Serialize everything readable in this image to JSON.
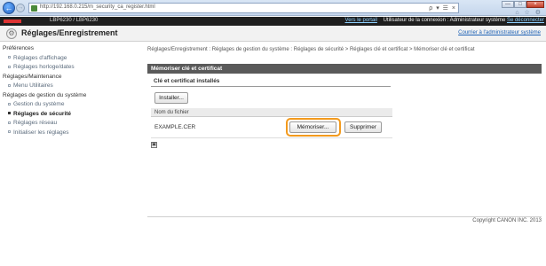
{
  "browser": {
    "url": "http://192.168.0.215/m_security_ca_register.html",
    "search_glyphs": "ρ ▾ ☰ ×",
    "tools_glyphs": "⌂ ☆ ⚙",
    "window_buttons": [
      "—",
      "□",
      "×"
    ]
  },
  "topbar": {
    "model": "LBP6230 / LBP6230",
    "portal_link": "Vers le portail",
    "user_text": "Utilisateur de la connexion : Administrateur système",
    "logout_link": "Se déconnecter"
  },
  "header": {
    "title": "Réglages/Enregistrement",
    "admin_link": "Courrier à l'administrateur système"
  },
  "sidebar": {
    "groups": [
      {
        "label": "Préférences",
        "items": [
          {
            "label": "Réglages d'affichage",
            "active": false
          },
          {
            "label": "Réglages horloge/dates",
            "active": false
          }
        ]
      },
      {
        "label": "Réglages/Maintenance",
        "items": [
          {
            "label": "Menu Utilitaires",
            "active": false
          }
        ]
      },
      {
        "label": "Réglages de gestion du système",
        "items": [
          {
            "label": "Gestion du système",
            "active": false
          },
          {
            "label": "Réglages de sécurité",
            "active": true
          },
          {
            "label": "Réglages réseau",
            "active": false
          },
          {
            "label": "Initialiser les réglages",
            "active": false
          }
        ]
      }
    ]
  },
  "main": {
    "breadcrumb": "Réglages/Enregistrement : Réglages de gestion du système : Réglages de sécurité > Réglages clé et certificat > Mémoriser clé et certificat",
    "section_title": "Mémoriser clé et certificat",
    "subsection_title": "Clé et certificat installés",
    "install_button": "Installer...",
    "table_header": "Nom du fichier",
    "file": {
      "name": "EXAMPLE.CER",
      "store_button": "Mémoriser...",
      "delete_button": "Supprimer"
    },
    "page_control": "▣"
  },
  "footer": {
    "copyright": "Copyright CANON INC. 2013"
  },
  "colors": {
    "highlight": "#f39a1d",
    "section_bar": "#5a5a5a",
    "topbar": "#1f1f1f"
  }
}
